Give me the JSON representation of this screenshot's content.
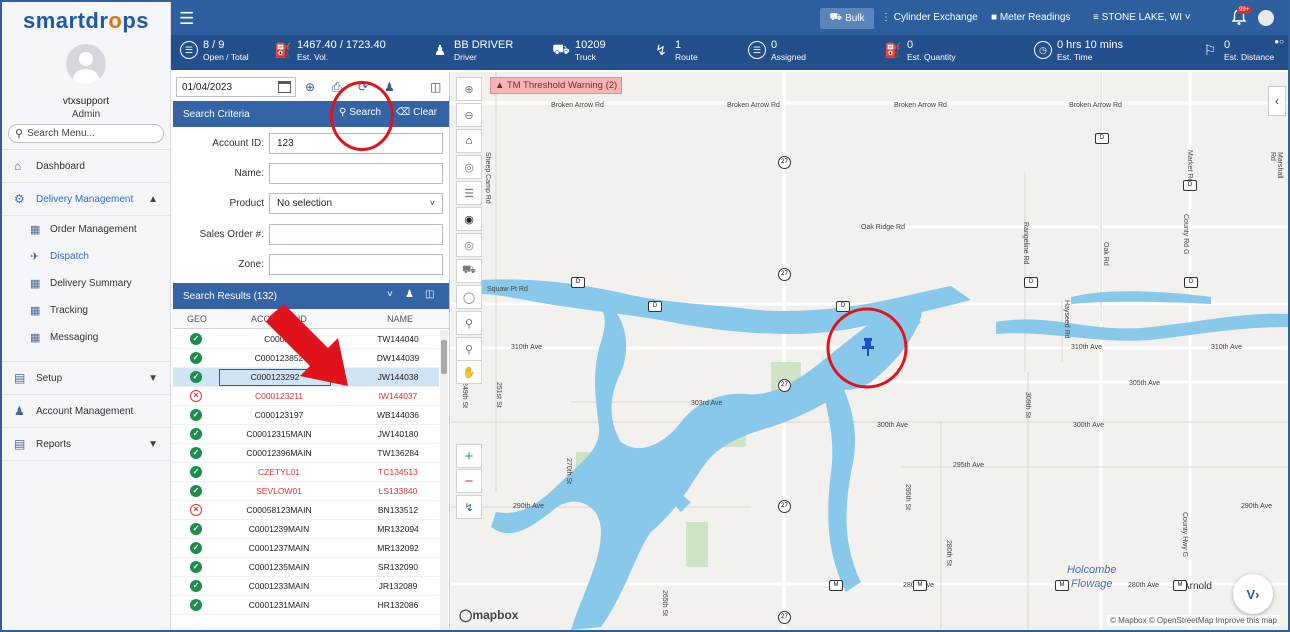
{
  "brand": {
    "name_left": "smartdr",
    "name_drop": "o",
    "name_right": "ps"
  },
  "user": {
    "name": "vtxsupport",
    "role": "Admin"
  },
  "search_menu": {
    "placeholder": "Search Menu..."
  },
  "sidebar": {
    "items": [
      {
        "label": "Dashboard"
      },
      {
        "label": "Delivery Management"
      },
      {
        "label": "Setup"
      },
      {
        "label": "Account Management"
      },
      {
        "label": "Reports"
      }
    ],
    "sub_items": [
      {
        "label": "Order Management"
      },
      {
        "label": "Dispatch"
      },
      {
        "label": "Delivery Summary"
      },
      {
        "label": "Tracking"
      },
      {
        "label": "Messaging"
      }
    ]
  },
  "topbar": {
    "bulk": "Bulk",
    "cylinder": "Cylinder Exchange",
    "meter": "Meter Readings",
    "location": "STONE LAKE, WI",
    "bell_badge": "99+"
  },
  "stats": [
    {
      "value": "8 / 9",
      "label": "Open / Total"
    },
    {
      "value": "1467.40 / 1723.40",
      "label": "Est. Vol."
    },
    {
      "value": "BB DRIVER",
      "label": "Driver"
    },
    {
      "value": "10209",
      "label": "Truck"
    },
    {
      "value": "1",
      "label": "Route"
    },
    {
      "value": "0",
      "label": "Assigned"
    },
    {
      "value": "0",
      "label": "Est. Quantity"
    },
    {
      "value": "0 hrs 10 mins",
      "label": "Est. Time"
    },
    {
      "value": "0",
      "label": "Est. Distance"
    }
  ],
  "panel": {
    "date": "01/04/2023",
    "criteria_title": "Search Criteria",
    "search_label": "Search",
    "clear_label": "Clear",
    "form": {
      "account_id_label": "Account ID:",
      "account_id_value": "123",
      "name_label": "Name:",
      "product_label": "Product",
      "product_value": "No selection",
      "sales_order_label": "Sales Order #:",
      "zone_label": "Zone:"
    },
    "results_title": "Search Results (132)",
    "columns": {
      "geo": "GEO",
      "account": "ACCOUNT ID",
      "name": "NAME"
    },
    "rows": [
      {
        "geo": "ok",
        "account": "C00012",
        "name": "TW144040",
        "red": false
      },
      {
        "geo": "ok",
        "account": "C000123852",
        "name": "DW144039",
        "red": false
      },
      {
        "geo": "ok",
        "account": "C000123292",
        "name": "JW144038",
        "red": false,
        "selected": true
      },
      {
        "geo": "bad",
        "account": "C000123211",
        "name": "IW144037",
        "red": true
      },
      {
        "geo": "ok",
        "account": "C000123197",
        "name": "WB144036",
        "red": false
      },
      {
        "geo": "ok",
        "account": "C00012315MAIN",
        "name": "JW140180",
        "red": false
      },
      {
        "geo": "ok",
        "account": "C00012396MAIN",
        "name": "TW136284",
        "red": false
      },
      {
        "geo": "ok",
        "account": "CZETYL01",
        "name": "TC134513",
        "red": true
      },
      {
        "geo": "ok",
        "account": "SEVLOW01",
        "name": "LS133840",
        "red": true
      },
      {
        "geo": "bad",
        "account": "C00058123MAIN",
        "name": "BN133512",
        "red": false
      },
      {
        "geo": "ok",
        "account": "C0001239MAIN",
        "name": "MR132094",
        "red": false
      },
      {
        "geo": "ok",
        "account": "C0001237MAIN",
        "name": "MR132092",
        "red": false
      },
      {
        "geo": "ok",
        "account": "C0001235MAIN",
        "name": "SR132090",
        "red": false
      },
      {
        "geo": "ok",
        "account": "C0001233MAIN",
        "name": "JR132089",
        "red": false
      },
      {
        "geo": "ok",
        "account": "C0001231MAIN",
        "name": "HR132086",
        "red": false
      }
    ]
  },
  "map": {
    "warning": "TM Threshold Warning (2)",
    "lake_name_1": "Holcombe",
    "lake_name_2": "Flowage",
    "town": "Arnold",
    "attribution": "© Mapbox © OpenStreetMap  Improve this map",
    "mapbox_logo": "mapbox",
    "roads": {
      "broken_arrow": "Broken Arrow Rd",
      "oak_ridge": "Oak Ridge Rd",
      "squaw_pt": "Squaw Pt Rd",
      "ave310": "310th Ave",
      "ave305": "305th Ave",
      "ave303": "303rd Ave",
      "ave300": "300th Ave",
      "ave295": "295th Ave",
      "ave290": "290th Ave",
      "ave280": "280th Ave",
      "sheep_camp": "Sheep Camp Rd",
      "market": "Market Rd",
      "marshall": "Marshall Rd",
      "rangeline": "Rangeline Rd",
      "oak": "Oak Rd",
      "hayseed": "Hayseed Rd",
      "county_g": "County Rd G",
      "county_y": "County Hwy G",
      "st270": "270th St",
      "st295": "295th St",
      "st309": "309th St",
      "st280": "280th St",
      "st249": "249th St",
      "st251": "251st St",
      "st265": "265th St",
      "hwy27": "27",
      "hwy_d": "D",
      "hwy_m": "M"
    }
  },
  "colors": {
    "header": "#2d5f9f",
    "stats": "#234f8c",
    "water": "#88c8ea",
    "annotation": "#e0121b",
    "pin": "#1f4fc2"
  }
}
